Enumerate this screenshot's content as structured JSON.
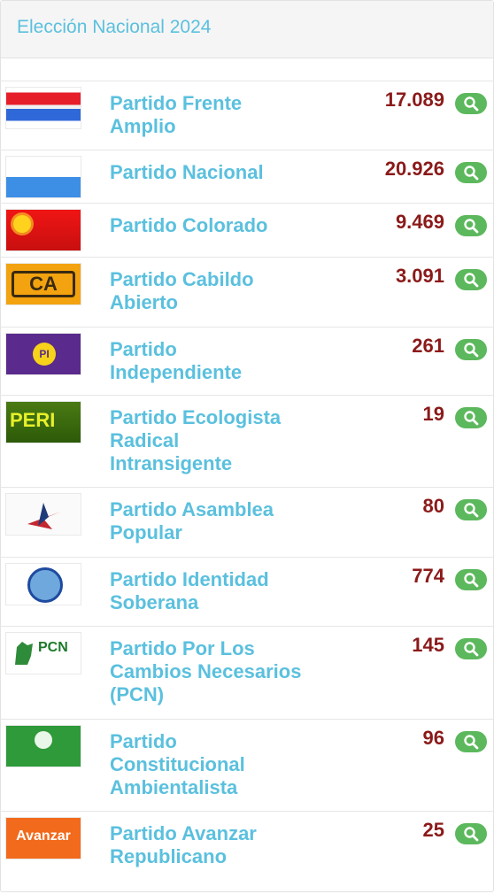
{
  "header": {
    "title": "Elección Nacional 2024"
  },
  "parties": [
    {
      "name": "Partido Frente Amplio",
      "votes": "17.089",
      "flag_icon": "frente-amplio-flag"
    },
    {
      "name": "Partido Nacional",
      "votes": "20.926",
      "flag_icon": "partido-nacional-flag"
    },
    {
      "name": "Partido Colorado",
      "votes": "9.469",
      "flag_icon": "partido-colorado-flag"
    },
    {
      "name": "Partido Cabildo Abierto",
      "votes": "3.091",
      "flag_icon": "cabildo-abierto-flag",
      "logo_text": "CA"
    },
    {
      "name": "Partido Independiente",
      "votes": "261",
      "flag_icon": "partido-independiente-flag",
      "logo_text": "PI"
    },
    {
      "name": "Partido Ecologista Radical Intransigente",
      "votes": "19",
      "flag_icon": "peri-flag",
      "logo_text": "PERI"
    },
    {
      "name": "Partido Asamblea Popular",
      "votes": "80",
      "flag_icon": "asamblea-popular-flag"
    },
    {
      "name": "Partido Identidad Soberana",
      "votes": "774",
      "flag_icon": "identidad-soberana-flag"
    },
    {
      "name": "Partido Por Los Cambios Necesarios (PCN)",
      "votes": "145",
      "flag_icon": "pcn-flag",
      "logo_text": "PCN"
    },
    {
      "name": "Partido Constitucional Ambientalista",
      "votes": "96",
      "flag_icon": "constitucional-ambientalista-flag"
    },
    {
      "name": "Partido Avanzar Republicano",
      "votes": "25",
      "flag_icon": "avanzar-republicano-flag",
      "logo_text": "Avanzar"
    }
  ],
  "colors": {
    "party_name": "#5bc0de",
    "votes": "#8b1a1a",
    "zoom_button": "#5cb85c",
    "header_bg": "#f5f5f5"
  }
}
